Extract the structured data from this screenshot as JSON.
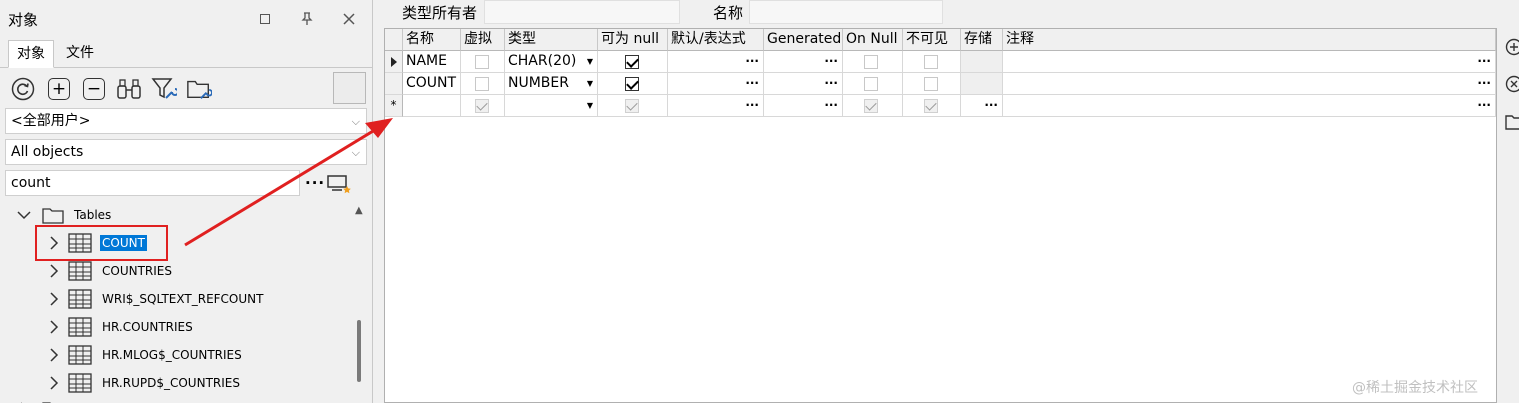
{
  "panel": {
    "title": "对象",
    "tabs": {
      "objects": "对象",
      "files": "文件"
    },
    "owner_select": "<全部用户>",
    "type_select": "All objects",
    "filter_value": "count",
    "filter_dots": "···"
  },
  "tree": {
    "folder_label": "Tables",
    "items": [
      {
        "label": "COUNT",
        "selected": true
      },
      {
        "label": "COUNTRIES",
        "selected": false
      },
      {
        "label": "WRI$_SQLTEXT_REFCOUNT",
        "selected": false
      },
      {
        "label": "HR.COUNTRIES",
        "selected": false
      },
      {
        "label": "HR.MLOG$_COUNTRIES",
        "selected": false
      },
      {
        "label": "HR.RUPD$_COUNTRIES",
        "selected": false
      }
    ]
  },
  "editor": {
    "owner_label": "类型所有者",
    "name_label": "名称",
    "columns": [
      "名称",
      "虚拟",
      "类型",
      "可为 null",
      "默认/表达式",
      "Generated",
      "On Null",
      "不可见",
      "存储",
      "注释"
    ],
    "rows": [
      {
        "marker": "",
        "name": "NAME",
        "type": "CHAR(20)",
        "nullable": true
      },
      {
        "marker": "",
        "name": "COUNT",
        "type": "NUMBER",
        "nullable": true
      },
      {
        "marker": "*",
        "name": "",
        "type": "",
        "nullable": true
      }
    ],
    "ellipsis": "···"
  },
  "watermark": "@稀土掘金技术社区",
  "colors": {
    "selection": "#0078d7",
    "annotation": "#e02020"
  }
}
